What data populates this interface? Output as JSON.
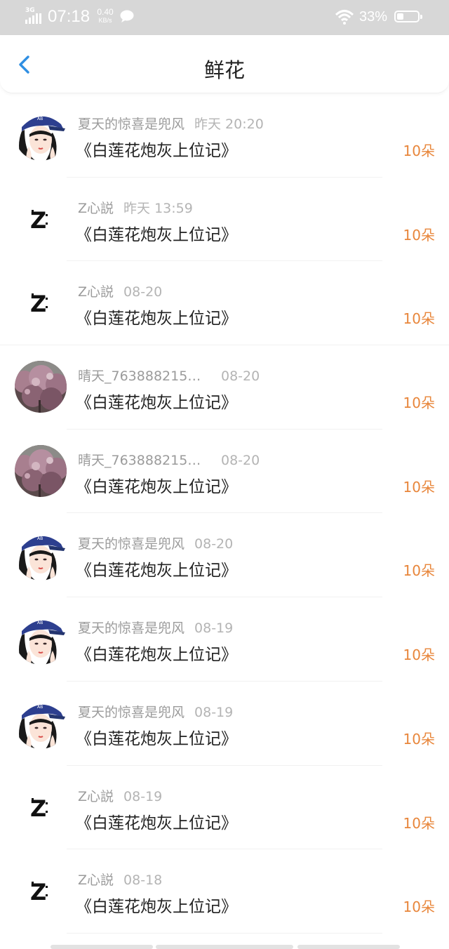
{
  "status_bar": {
    "network": "3G",
    "time": "07:18",
    "speed_value": "0.40",
    "speed_unit": "KB/s",
    "battery_percent": "33%",
    "battery_level": 0.33
  },
  "nav": {
    "title": "鲜花"
  },
  "colors": {
    "accent_blue": "#2f8fe3",
    "flower_orange": "#e8863b",
    "status_bar_bg": "#d7d7d7"
  },
  "records": [
    {
      "avatar": "girl-cap",
      "user": "夏天的惊喜是兜风",
      "time": "昨天 20:20",
      "book": "《白莲花炮灰上位记》",
      "flowers": "10朵"
    },
    {
      "avatar": "z-logo",
      "user": "Z心説",
      "time": "昨天 13:59",
      "book": "《白莲花炮灰上位记》",
      "flowers": "10朵"
    },
    {
      "avatar": "z-logo",
      "user": "Z心説",
      "time": "08-20",
      "book": "《白莲花炮灰上位记》",
      "flowers": "10朵"
    },
    {
      "avatar": "blossom-tree",
      "user": "晴天_763888215…",
      "time": "08-20",
      "book": "《白莲花炮灰上位记》",
      "flowers": "10朵"
    },
    {
      "avatar": "blossom-tree",
      "user": "晴天_763888215…",
      "time": "08-20",
      "book": "《白莲花炮灰上位记》",
      "flowers": "10朵"
    },
    {
      "avatar": "girl-cap",
      "user": "夏天的惊喜是兜风",
      "time": "08-20",
      "book": "《白莲花炮灰上位记》",
      "flowers": "10朵"
    },
    {
      "avatar": "girl-cap",
      "user": "夏天的惊喜是兜风",
      "time": "08-19",
      "book": "《白莲花炮灰上位记》",
      "flowers": "10朵"
    },
    {
      "avatar": "girl-cap",
      "user": "夏天的惊喜是兜风",
      "time": "08-19",
      "book": "《白莲花炮灰上位记》",
      "flowers": "10朵"
    },
    {
      "avatar": "z-logo",
      "user": "Z心説",
      "time": "08-19",
      "book": "《白莲花炮灰上位记》",
      "flowers": "10朵"
    },
    {
      "avatar": "z-logo",
      "user": "Z心説",
      "time": "08-18",
      "book": "《白莲花炮灰上位记》",
      "flowers": "10朵"
    }
  ]
}
